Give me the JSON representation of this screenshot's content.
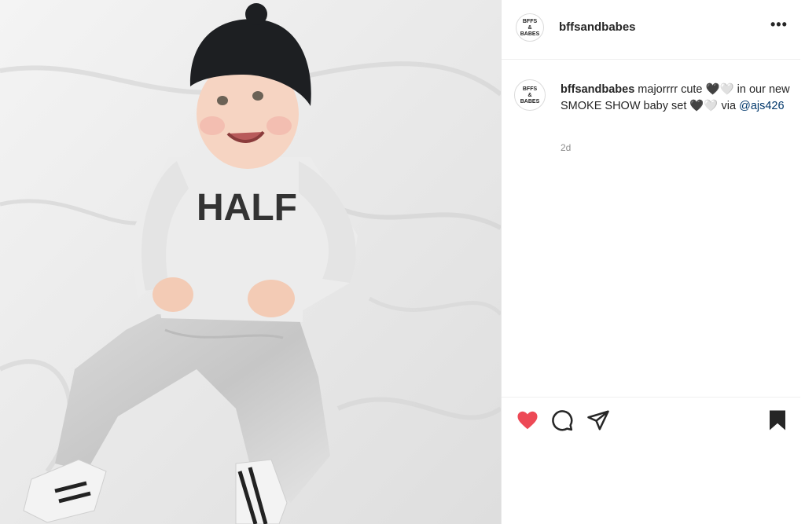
{
  "post": {
    "username": "bffsandbabes",
    "more_label": "•••",
    "avatar_text_line1": "BFFS",
    "avatar_text_line2": "&",
    "avatar_text_line3": "BABES"
  },
  "caption": {
    "username": "bffsandbabes",
    "text_part1": "majorrrr cute 🖤🤍 in our new SMOKE SHOW baby set 🖤🤍 via",
    "mention": "@ajs426",
    "timestamp": "2d"
  },
  "photo": {
    "shirt_text": "HALF"
  },
  "actions": {
    "icons": [
      "heart-icon",
      "comment-icon",
      "share-icon",
      "bookmark-icon"
    ],
    "liked": true,
    "heart_color": "#ed4956"
  }
}
